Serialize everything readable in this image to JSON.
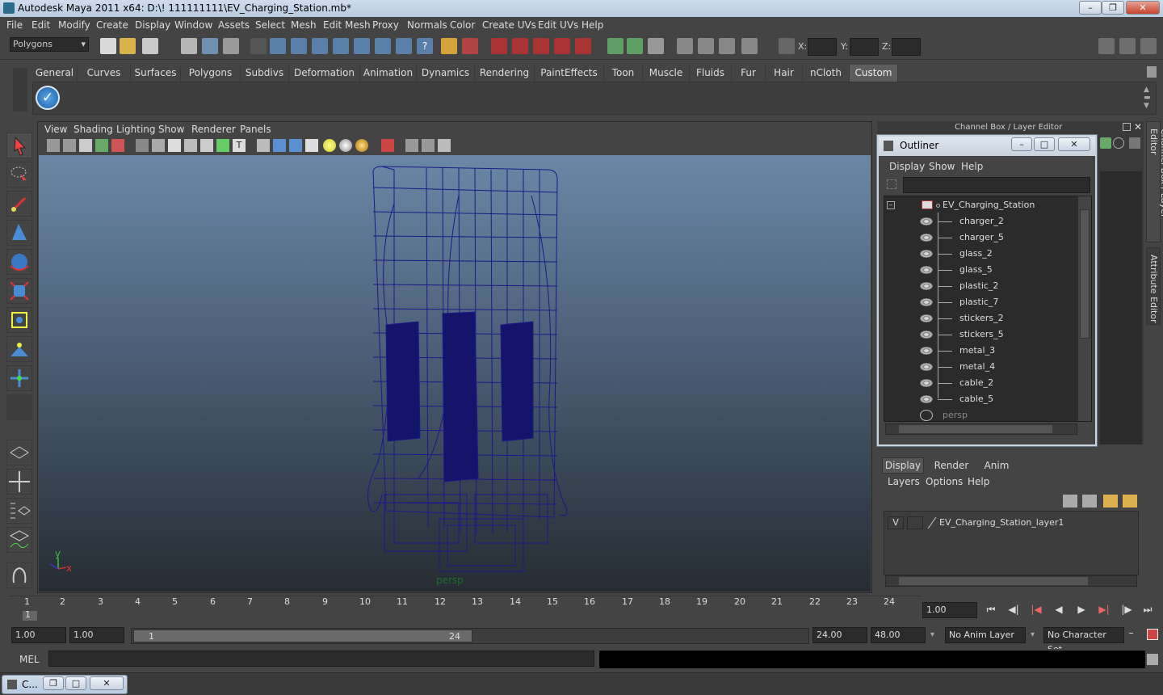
{
  "window": {
    "title": "Autodesk Maya 2011 x64: D:\\! 111111111\\EV_Charging_Station.mb*"
  },
  "menu": [
    "File",
    "Edit",
    "Modify",
    "Create",
    "Display",
    "Window",
    "Assets",
    "Select",
    "Mesh",
    "Edit Mesh",
    "Proxy",
    "Normals",
    "Color",
    "Create UVs",
    "Edit UVs",
    "Help"
  ],
  "status": {
    "mode": "Polygons",
    "x_label": "X:",
    "y_label": "Y:",
    "z_label": "Z:"
  },
  "shelf_tabs": [
    "General",
    "Curves",
    "Surfaces",
    "Polygons",
    "Subdivs",
    "Deformation",
    "Animation",
    "Dynamics",
    "Rendering",
    "PaintEffects",
    "Toon",
    "Muscle",
    "Fluids",
    "Fur",
    "Hair",
    "nCloth",
    "Custom"
  ],
  "shelf_active": "Custom",
  "viewport": {
    "menu": [
      "View",
      "Shading",
      "Lighting",
      "Show",
      "Renderer",
      "Panels"
    ],
    "camera_label": "persp",
    "axis_y": "y",
    "axis_x": "x"
  },
  "channel_box": {
    "title": "Channel Box / Layer Editor",
    "side_tab_1": "Channel Box / Layer Editor",
    "side_tab_2": "Attribute Editor"
  },
  "outliner": {
    "title": "Outliner",
    "menu": [
      "Display",
      "Show",
      "Help"
    ],
    "root": "EV_Charging_Station",
    "children": [
      "charger_2",
      "charger_5",
      "glass_2",
      "glass_5",
      "plastic_2",
      "plastic_7",
      "stickers_2",
      "stickers_5",
      "metal_3",
      "metal_4",
      "cable_2",
      "cable_5"
    ],
    "camera": "persp"
  },
  "layers": {
    "tabs": [
      "Display",
      "Render",
      "Anim"
    ],
    "menu": [
      "Layers",
      "Options",
      "Help"
    ],
    "visible": "V",
    "layer_name": "EV_Charging_Station_layer1"
  },
  "timeline": {
    "ticks": [
      "1",
      "2",
      "3",
      "4",
      "5",
      "6",
      "7",
      "8",
      "9",
      "10",
      "11",
      "12",
      "13",
      "14",
      "15",
      "16",
      "17",
      "18",
      "19",
      "20",
      "21",
      "22",
      "23",
      "24"
    ],
    "current_frame": "1",
    "current_time": "1.00"
  },
  "range": {
    "start": "1.00",
    "start2": "1.00",
    "slider_start": "1",
    "slider_end": "24",
    "end": "24.00",
    "end2": "48.00",
    "anim_layer": "No Anim Layer",
    "char_set": "No Character Set"
  },
  "mel": {
    "label": "MEL"
  },
  "taskbar": {
    "item": "C..."
  }
}
